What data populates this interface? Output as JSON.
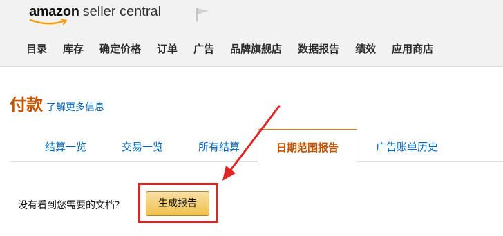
{
  "header": {
    "logo": {
      "brand": "amazon",
      "product": "seller central"
    },
    "flag_icon": "flag-icon",
    "nav": [
      "目录",
      "库存",
      "确定价格",
      "订单",
      "广告",
      "品牌旗舰店",
      "数据报告",
      "绩效",
      "应用商店"
    ]
  },
  "page": {
    "title": "付款",
    "learn_more": "了解更多信息"
  },
  "tabs": [
    {
      "label": "结算一览",
      "active": false
    },
    {
      "label": "交易一览",
      "active": false
    },
    {
      "label": "所有结算",
      "active": false
    },
    {
      "label": "日期范围报告",
      "active": true
    },
    {
      "label": "广告账单历史",
      "active": false
    }
  ],
  "report": {
    "question": "没有看到您需要的文档?",
    "button_label": "生成报告"
  },
  "colors": {
    "accent": "#c45500",
    "link": "#0066c0",
    "button": "#f0c14b",
    "annotation": "#e02424"
  }
}
